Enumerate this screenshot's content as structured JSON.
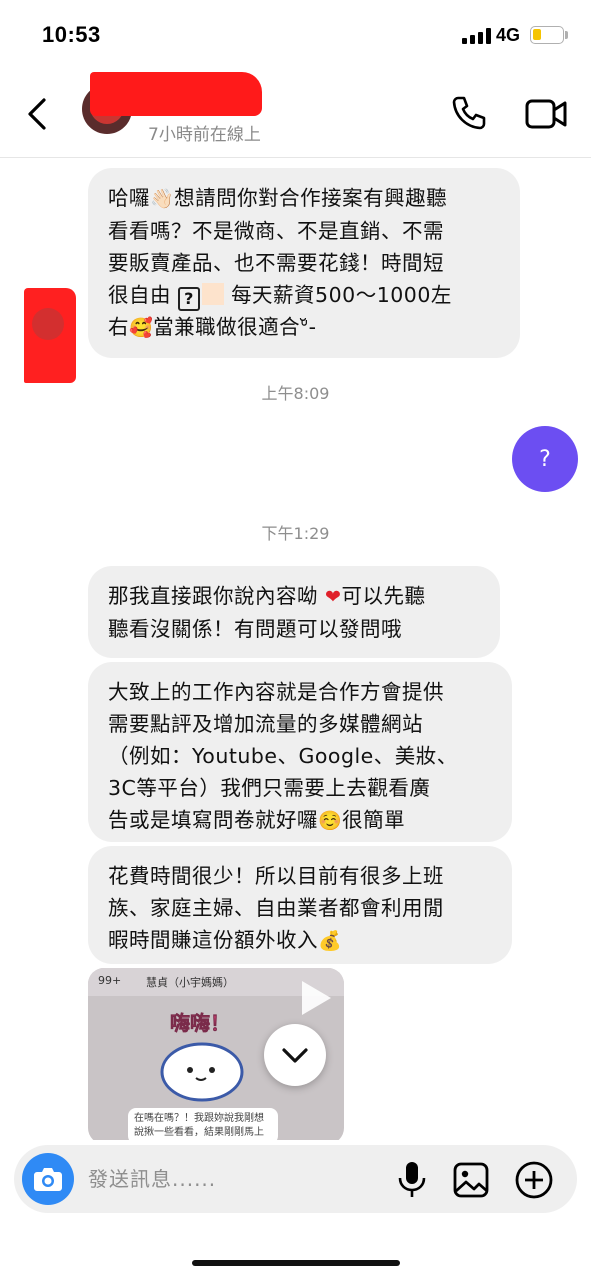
{
  "status_bar": {
    "time": "10:53",
    "network": "4G"
  },
  "header": {
    "presence": "7小時前在線上"
  },
  "messages": {
    "m1": {
      "l1a": "哈囉",
      "l1b": "想請問你對合作接案有興趣聽",
      "l2": "看看嗎？不是微商、不是直銷、不需",
      "l3": "要販賣產品、也不需要花錢！時間短",
      "l4a": "很自由",
      "l4b": "每天薪資500～1000左",
      "l5a": "右",
      "l5b": "當兼職做很適合",
      "l5c": "ᐡ̆-"
    },
    "time1": "上午8:09",
    "reply": "?",
    "time2": "下午1:29",
    "m2": {
      "l1a": "那我直接跟你說內容呦",
      "l1b": "可以先聽",
      "l2": "聽看沒關係！有問題可以發問哦"
    },
    "m3": {
      "l1": "大致上的工作內容就是合作方會提供",
      "l2": "需要點評及增加流量的多媒體網站",
      "l3": "（例如：Youtube、Google、美妝、",
      "l4": "3C等平台）我們只需要上去觀看廣",
      "l5a": "告或是填寫問卷就好囉",
      "l5b": "很簡單"
    },
    "m4": {
      "l1": "花費時間很少！所以目前有很多上班",
      "l2": "族、家庭主婦、自由業者都會利用閒",
      "l3": "暇時間賺這份額外收入"
    }
  },
  "media_preview": {
    "back_count": "99+",
    "contact": "慧貞（小宇媽媽）",
    "sticker_text": "嗨嗨！",
    "bubble_text": "在嗎在嗎？！我跟妳說我剛想說揪一些看看，結果剛剛馬上"
  },
  "composer": {
    "placeholder": "發送訊息......"
  },
  "icons": {
    "back": "chevron-left-icon",
    "call": "phone-icon",
    "video": "video-camera-icon",
    "camera": "camera-icon",
    "mic": "microphone-icon",
    "gallery": "image-icon",
    "add": "plus-circle-icon",
    "scroll": "chevron-down-icon",
    "play": "play-icon"
  },
  "colors": {
    "incoming_bubble": "#efefef",
    "outgoing_bubble": "#6c4ef2",
    "camera_button": "#2f8af5",
    "redaction": "#ff1a1a"
  }
}
